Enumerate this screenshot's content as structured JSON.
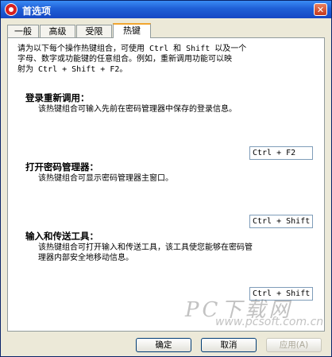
{
  "window": {
    "title": "首选项",
    "close_label": "✕"
  },
  "tabs": [
    {
      "label": "一般",
      "active": false
    },
    {
      "label": "高级",
      "active": false
    },
    {
      "label": "受限",
      "active": false
    },
    {
      "label": "热键",
      "active": true
    }
  ],
  "panel": {
    "intro_line1": "请为以下每个操作热键组合，可使用 Ctrl 和 Shift 以及一个",
    "intro_line2": "字母、数字或功能键的任意组合。例如，重新调用功能可以映",
    "intro_line3": "射为 Ctrl + Shift + F2。",
    "sections": [
      {
        "title": "登录重新调用：",
        "description": "该热键组合可输入先前在密码管理器中保存的登录信息。",
        "hotkey": "Ctrl + F2"
      },
      {
        "title": "打开密码管理器：",
        "description": "该热键组合可显示密码管理器主窗口。",
        "hotkey": "Ctrl + Shift"
      },
      {
        "title": "输入和传送工具：",
        "description_line1": "该热键组合可打开输入和传送工具，该工具使您能够在密码管",
        "description_line2": "理器内部安全地移动信息。",
        "hotkey": "Ctrl + Shift"
      }
    ]
  },
  "buttons": {
    "ok": "确定",
    "cancel": "取消",
    "apply": "应用(A)"
  },
  "watermark": {
    "text": "PC下载网",
    "url": "www.pcsoft.com.cn"
  }
}
